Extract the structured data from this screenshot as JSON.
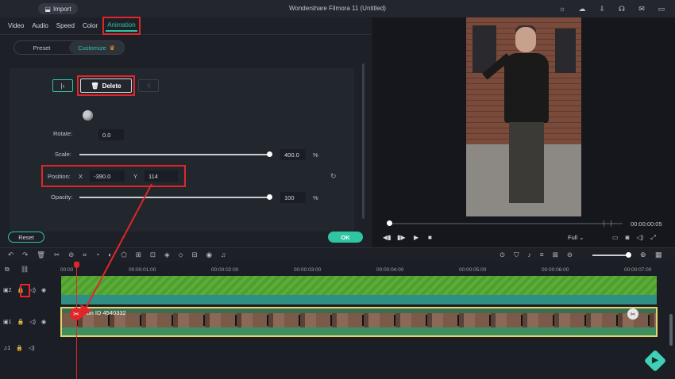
{
  "app": {
    "title": "Wondershare Filmora 11 (Untitled)",
    "import_label": "Import"
  },
  "tabs": [
    {
      "label": "Video",
      "active": false
    },
    {
      "label": "Audio",
      "active": false
    },
    {
      "label": "Speed",
      "active": false
    },
    {
      "label": "Color",
      "active": false
    },
    {
      "label": "Animation",
      "active": true
    }
  ],
  "subtabs": {
    "preset": "Preset",
    "customize": "Customize"
  },
  "keyframe": {
    "delete_label": "Delete"
  },
  "properties": {
    "rotate": {
      "label": "Rotate:",
      "value": "0.0"
    },
    "scale": {
      "label": "Scale:",
      "value": "400.0",
      "unit": "%",
      "level": 1.0
    },
    "position": {
      "label": "Position:",
      "x_label": "X",
      "x_value": "-390.0",
      "y_label": "Y",
      "y_value": "114"
    },
    "opacity": {
      "label": "Opacity:",
      "value": "100",
      "unit": "%",
      "level": 1.0
    }
  },
  "buttons": {
    "reset": "Reset",
    "ok": "OK"
  },
  "preview": {
    "timecode": "00:00:00:05",
    "quality": "Full",
    "scrub_progress": 0.01
  },
  "timeline": {
    "ruler_ticks": [
      "00:00",
      "00:00:01:00",
      "00:00:02:00",
      "00:00:03:00",
      "00:00:04:00",
      "00:00:05:00",
      "00:00:06:00",
      "00:00:07:00"
    ],
    "tracks": [
      {
        "number": "2"
      },
      {
        "number": "1"
      },
      {
        "number": "1"
      }
    ],
    "video_clip_label": "ction ID 4540332"
  },
  "colors": {
    "accent": "#2ec5a3",
    "highlight": "#e0262a",
    "clip_border": "#e7d36b"
  }
}
